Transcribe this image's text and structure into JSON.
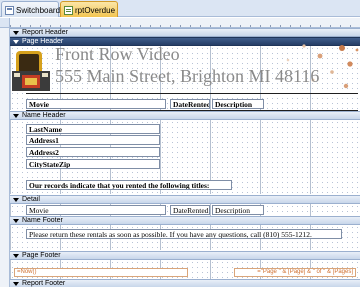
{
  "tabs": [
    {
      "label": "Switchboard",
      "icon": "form-icon",
      "active": false
    },
    {
      "label": "rptOverdue",
      "icon": "report-icon",
      "active": true
    }
  ],
  "sections": {
    "report_header": "Report Header",
    "page_header": "Page Header",
    "name_header": "Name Header",
    "detail": "Detail",
    "name_footer": "Name Footer",
    "page_footer": "Page Footer",
    "report_footer": "Report Footer"
  },
  "page_header": {
    "company": "Front Row Video",
    "address": "555 Main Street, Brighton MI 48116",
    "col_movie": "Movie",
    "col_date_rented": "DateRented",
    "col_description": "Description"
  },
  "name_header": {
    "last_name": "LastName",
    "address1": "Address1",
    "address2": "Address2",
    "city_state_zip": "CityStateZip",
    "message": "Our records indicate that you rented the following titles:"
  },
  "detail": {
    "movie": "Movie",
    "date_rented": "DateRented",
    "description": "Description"
  },
  "name_footer": {
    "message": "Please return these rentals as soon as possible.  If you have any questions, call (810) 555-1212."
  },
  "page_footer": {
    "date_expr": "=Now()",
    "page_expr": "=\"Page \" & [Page] & \" of \" & [Pages]"
  },
  "colors": {
    "selected_section": "#2d4a78",
    "active_tab": "#f3c551",
    "title_gray": "#8a8a8a",
    "footer_orange": "#d07030"
  }
}
